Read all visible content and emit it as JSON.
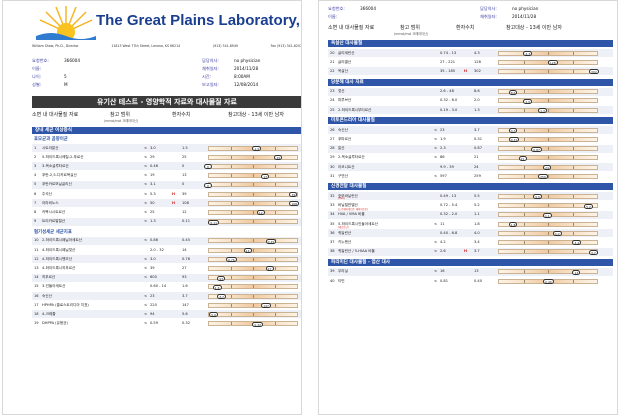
{
  "lab": {
    "name": "The Great Plains Laboratory, Inc.",
    "address_parts": [
      "William Shaw, Ph.D., Director",
      "11813 West 77th Street, Lenexa, KS 66214",
      "(913) 341-8949",
      "Fax (913) 341-6207"
    ]
  },
  "patient_info_left": [
    {
      "label": "요청번호:",
      "value": "366004"
    },
    {
      "label": "이름:",
      "value": ""
    },
    {
      "label": "나이:",
      "value": "5"
    },
    {
      "label": "성별:",
      "value": "M"
    }
  ],
  "patient_info_right": [
    {
      "label": "담당의사:",
      "value": "no physician"
    },
    {
      "label": "채취일자:",
      "value": "2014/11/28"
    },
    {
      "label": "시간:",
      "value": "8:00AM"
    },
    {
      "label": "보고일자:",
      "value": "12/08/2014"
    }
  ],
  "report": {
    "title": "유기산 테스트 - 영양학적 자료와 대사물질 자료",
    "col_test": "소변 내 대사물질 자료",
    "col_ref": "참고 범위",
    "col_ref_sub": "(mmol/mol 크레아티닌)",
    "col_patient": "환자수치",
    "col_ref_pop": "참고대상 - 13세 이만 남자"
  },
  "right_header": {
    "request_label": "요청번호:",
    "request_value": "366004",
    "name_label": "이름:",
    "physician_label": "담당의사:",
    "physician_value": "no physician",
    "date_label": "채취일자:",
    "date_value": "2014/11/28",
    "col_test": "소변 내 대사물질 자료",
    "col_ref": "참고 범위",
    "col_ref_sub": "(mmol/mol 크레아티닌)",
    "col_patient": "환자수치",
    "col_ref_pop": "참고대상 - 13세 이만 남자"
  },
  "left_sections": [
    {
      "title": "장내 세균 이상증식",
      "subhead": "효모균과 곰팡이균",
      "rows": [
        {
          "no": "1",
          "name": "시트라말산",
          "lt": "≤",
          "ref": "3.0",
          "value": "1.5",
          "flag": "",
          "pos": 0.55
        },
        {
          "no": "2",
          "name": "5-하이드록시메틸-2-푸로산",
          "lt": "≤",
          "ref": "29",
          "value": "25",
          "flag": "",
          "pos": 0.8
        },
        {
          "no": "3",
          "name": "3-옥소글루타르산",
          "lt": "≤",
          "ref": "0.46",
          "value": "0",
          "flag": "",
          "pos": 0.0
        },
        {
          "no": "4",
          "name": "푸란-2,5-디카르복실산",
          "lt": "≤",
          "ref": "19",
          "value": "13",
          "flag": "",
          "pos": 0.65
        },
        {
          "no": "5",
          "name": "푸란카르보닐글리신",
          "lt": "≤",
          "ref": "3.1",
          "value": "0",
          "flag": "",
          "pos": 0.0
        },
        {
          "no": "6",
          "name": "주석산",
          "lt": "≤",
          "ref": "5.3",
          "value": "39",
          "flag": "H",
          "pos": 0.97
        },
        {
          "no": "7",
          "name": "아라비노스",
          "lt": "≤",
          "ref": "50",
          "value": "108",
          "flag": "H",
          "pos": 0.97
        },
        {
          "no": "8",
          "name": "카복시시트르산",
          "lt": "≤",
          "ref": "25",
          "value": "12",
          "flag": "",
          "pos": 0.6
        },
        {
          "no": "9",
          "name": "트리카르발릴산",
          "lt": "≤",
          "ref": "1.3",
          "value": "0.11",
          "flag": "",
          "pos": 0.05
        }
      ]
    },
    {
      "title": "",
      "subhead": "혐기성세균 세균지표",
      "rows": [
        {
          "no": "10",
          "name": "2-하이드록시페닐아세트산",
          "lt": "≤",
          "ref": "0.86",
          "value": "0.45",
          "flag": "",
          "pos": 0.7
        },
        {
          "no": "11",
          "name": "4-하이드록시페닐젖산",
          "lt": "",
          "ref": "2.0 - 32",
          "value": "14",
          "flag": "",
          "pos": 0.45
        },
        {
          "no": "12",
          "name": "4-하이드록시벤조산",
          "lt": "≤",
          "ref": "3.0",
          "value": "0.76",
          "flag": "",
          "pos": 0.25
        },
        {
          "no": "13",
          "name": "4-하이드록시히푸르산",
          "lt": "≤",
          "ref": "39",
          "value": "27",
          "flag": "",
          "pos": 0.7
        },
        {
          "no": "14",
          "name": "히푸르산",
          "lt": "≤",
          "ref": "600",
          "value": "93",
          "flag": "",
          "pos": 0.15
        },
        {
          "no": "15",
          "name": "3-인돌아세트산",
          "lt": "",
          "ref": "0.60 - 14",
          "value": "1.6",
          "flag": "",
          "pos": 0.1
        },
        {
          "no": "16",
          "name": "숙신산",
          "lt": "≤",
          "ref": "23",
          "value": "3.7",
          "flag": "",
          "pos": 0.15
        },
        {
          "no": "17",
          "name": "HPHPA (클로스트리디아 지표)",
          "lt": "≤",
          "ref": "220",
          "value": "147",
          "flag": "",
          "pos": 0.65
        },
        {
          "no": "18",
          "name": "4-크레졸",
          "lt": "≤",
          "ref": "94",
          "value": "5.6",
          "flag": "",
          "pos": 0.06
        },
        {
          "no": "19",
          "name": "DHPPA (유용균)",
          "lt": "≤",
          "ref": "0.59",
          "value": "0.32",
          "flag": "",
          "pos": 0.55
        }
      ]
    }
  ],
  "right_sections": [
    {
      "title": "옥살산 대사물질",
      "rows": [
        {
          "no": "20",
          "name": "글리세린산",
          "lt": "",
          "ref": "0.74 - 13",
          "value": "4.3",
          "flag": "",
          "pos": 0.3
        },
        {
          "no": "21",
          "name": "글리콜산",
          "lt": "",
          "ref": "27 - 221",
          "value": "128",
          "flag": "",
          "pos": 0.55
        },
        {
          "no": "22",
          "name": "옥살산",
          "lt": "",
          "ref": "35 - 185",
          "value": "302",
          "flag": "H",
          "pos": 0.97
        }
      ]
    },
    {
      "title": "당분해 대사 자료",
      "rows": [
        {
          "no": "23",
          "name": "젖산",
          "lt": "",
          "ref": "2.6 - 48",
          "value": "8.6",
          "flag": "",
          "pos": 0.15
        },
        {
          "no": "24",
          "name": "피루브산",
          "lt": "",
          "ref": "0.32 - 6.0",
          "value": "2.0",
          "flag": "",
          "pos": 0.3
        },
        {
          "no": "25",
          "name": "2-하이드록시부티르산",
          "lt": "",
          "ref": "0.19 - 3.0",
          "value": "1.3",
          "flag": "",
          "pos": 0.45
        }
      ]
    },
    {
      "title": "미토콘드리아 대사물질",
      "rows": [
        {
          "no": "26",
          "name": "숙신산",
          "lt": "≤",
          "ref": "23",
          "value": "3.7",
          "flag": "",
          "pos": 0.15
        },
        {
          "no": "27",
          "name": "푸마르산",
          "lt": "≤",
          "ref": "1.9",
          "value": "0.31",
          "flag": "",
          "pos": 0.15
        },
        {
          "no": "28",
          "name": "말산",
          "lt": "≤",
          "ref": "2.3",
          "value": "0.87",
          "flag": "",
          "pos": 0.38
        },
        {
          "no": "29",
          "name": "2-옥소글루타르산",
          "lt": "≤",
          "ref": "86",
          "value": "21",
          "flag": "",
          "pos": 0.25
        },
        {
          "no": "30",
          "name": "아코니트산",
          "lt": "",
          "ref": "9.9 - 39",
          "value": "24",
          "flag": "",
          "pos": 0.5
        },
        {
          "no": "31",
          "name": "구연산",
          "lt": "≤",
          "ref": "597",
          "value": "259",
          "flag": "",
          "pos": 0.45
        }
      ]
    },
    {
      "title": "신경전달 대사물질",
      "rows": [
        {
          "no": "32",
          "name": "호모바닐린산",
          "note": "(HVA)",
          "lt": "",
          "ref": "0.49 - 13",
          "value": "5.5",
          "flag": "",
          "pos": 0.4
        },
        {
          "no": "33",
          "name": "바닐릴만델산",
          "note": "(노르에피네프린, 에피네프린)",
          "lt": "",
          "ref": "0.72 - 5.4",
          "value": "5.2",
          "flag": "",
          "pos": 0.92
        },
        {
          "no": "34",
          "name": "HVA / VMA 비율",
          "lt": "",
          "ref": "0.32 - 2.0",
          "value": "1.1",
          "flag": "",
          "pos": 0.5
        },
        {
          "no": "35",
          "name": "5-하이드록시인돌아세트산",
          "note": "(세로토닌)",
          "lt": "≤",
          "ref": "11",
          "value": "1.8",
          "flag": "",
          "pos": 0.15
        },
        {
          "no": "36",
          "name": "퀴놀린산",
          "lt": "",
          "ref": "0.40 - 6.8",
          "value": "4.0",
          "flag": "",
          "pos": 0.6
        },
        {
          "no": "37",
          "name": "키누렌산",
          "lt": "≤",
          "ref": "4.2",
          "value": "3.4",
          "flag": "",
          "pos": 0.8
        },
        {
          "no": "38",
          "name": "퀴놀린산 / 5-HIAA 비율",
          "lt": "≤",
          "ref": "2.6",
          "value": "3.7",
          "flag": "H",
          "pos": 0.97
        }
      ]
    },
    {
      "title": "피리미딘 대사물질 - 엽산 대사",
      "rows": [
        {
          "no": "39",
          "name": "우라실",
          "lt": "≤",
          "ref": "16",
          "value": "13",
          "flag": "",
          "pos": 0.8
        },
        {
          "no": "40",
          "name": "티민",
          "lt": "≤",
          "ref": "0.81",
          "value": "0.40",
          "flag": "",
          "pos": 0.5
        }
      ]
    }
  ]
}
